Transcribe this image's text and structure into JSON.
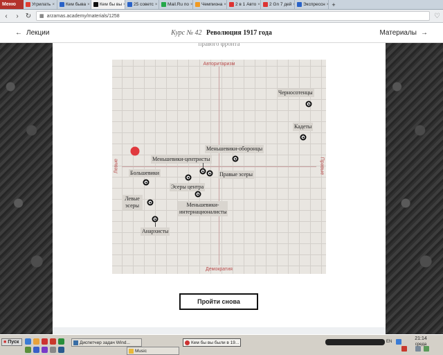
{
  "browser": {
    "menu_label": "Меню",
    "tabs": [
      {
        "label": "Угрилать",
        "color": "#e03c31",
        "active": false
      },
      {
        "label": "Кем быва",
        "color": "#2962c7",
        "active": false
      },
      {
        "label": "Кем бы вы",
        "color": "#111111",
        "active": true
      },
      {
        "label": "25 советс",
        "color": "#2962c7",
        "active": false
      },
      {
        "label": "Mail.Ru по",
        "color": "#26a84a",
        "active": false
      },
      {
        "label": "Чемпиона",
        "color": "#f09a22",
        "active": false
      },
      {
        "label": "2 в 1 Авто",
        "color": "#d33",
        "active": false
      },
      {
        "label": "2 Gn 7 дей",
        "color": "#d33",
        "active": false
      },
      {
        "label": "Экспрессн",
        "color": "#2962c7",
        "active": false
      }
    ],
    "url": "arzamas.academy/materials/1258"
  },
  "header": {
    "back_label": "Лекции",
    "course_number": "Курс № 42",
    "course_title": "Революция 1917 года",
    "materials_label": "Материалы"
  },
  "quiz": {
    "cut_text": "правого фронта",
    "axes": {
      "top": "Авторитаризм",
      "bottom": "Демократия",
      "left": "Левые",
      "right": "Правые"
    },
    "parties": [
      {
        "label": "Черносотенцы"
      },
      {
        "label": "Кадеты"
      },
      {
        "label": "Меньшевики-оборонцы"
      },
      {
        "label": "Меньшевики-центристы"
      },
      {
        "label": "Правые эсеры"
      },
      {
        "label": "Большевики"
      },
      {
        "label": "Эсеры центра"
      },
      {
        "label": "Левые эсеры"
      },
      {
        "label": "Меньшевики-интернационалисты"
      },
      {
        "label": "Анархисты"
      }
    ],
    "user_color": "#e0393e",
    "retry_label": "Пройти снова"
  },
  "taskbar": {
    "start_label": "Пуск",
    "tasks": [
      {
        "label": "Диспетчер задач Wind..."
      },
      {
        "label": "Music"
      },
      {
        "label": "Кем бы вы были в 19..."
      }
    ],
    "lang": "EN",
    "time": "21:14",
    "day": "среда"
  }
}
